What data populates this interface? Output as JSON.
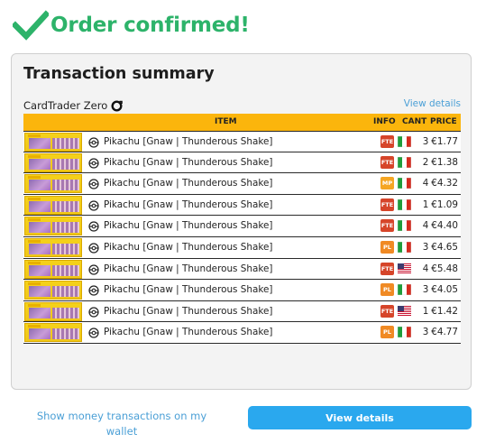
{
  "header": {
    "title": "Order confirmed!",
    "icon": "check-icon",
    "color": "#2db36a"
  },
  "summary": {
    "title": "Transaction summary",
    "seller": "CardTrader Zero",
    "view_details_link": "View details",
    "columns": {
      "item": "ITEM",
      "info": "INFO",
      "cant": "CANT",
      "price": "PRICE"
    },
    "rows": [
      {
        "name": "Pikachu [Gnaw | Thunderous Shake]",
        "condition": "FTE",
        "cond_color": "#d6452a",
        "flag": "it",
        "qty": "3",
        "price": "€1.77"
      },
      {
        "name": "Pikachu [Gnaw | Thunderous Shake]",
        "condition": "FTE",
        "cond_color": "#d6452a",
        "flag": "it",
        "qty": "2",
        "price": "€1.38"
      },
      {
        "name": "Pikachu [Gnaw | Thunderous Shake]",
        "condition": "MP",
        "cond_color": "#f5a623",
        "flag": "it",
        "qty": "4",
        "price": "€4.32"
      },
      {
        "name": "Pikachu [Gnaw | Thunderous Shake]",
        "condition": "FTE",
        "cond_color": "#d6452a",
        "flag": "it",
        "qty": "1",
        "price": "€1.09"
      },
      {
        "name": "Pikachu [Gnaw | Thunderous Shake]",
        "condition": "FTE",
        "cond_color": "#d6452a",
        "flag": "it",
        "qty": "4",
        "price": "€4.40"
      },
      {
        "name": "Pikachu [Gnaw | Thunderous Shake]",
        "condition": "PL",
        "cond_color": "#f08a24",
        "flag": "it",
        "qty": "3",
        "price": "€4.65"
      },
      {
        "name": "Pikachu [Gnaw | Thunderous Shake]",
        "condition": "FTE",
        "cond_color": "#d6452a",
        "flag": "us",
        "qty": "4",
        "price": "€5.48"
      },
      {
        "name": "Pikachu [Gnaw | Thunderous Shake]",
        "condition": "PL",
        "cond_color": "#f08a24",
        "flag": "it",
        "qty": "3",
        "price": "€4.05"
      },
      {
        "name": "Pikachu [Gnaw | Thunderous Shake]",
        "condition": "FTE",
        "cond_color": "#d6452a",
        "flag": "us",
        "qty": "1",
        "price": "€1.42"
      },
      {
        "name": "Pikachu [Gnaw | Thunderous Shake]",
        "condition": "PL",
        "cond_color": "#f08a24",
        "flag": "it",
        "qty": "3",
        "price": "€4.77"
      }
    ]
  },
  "footer": {
    "wallet_link": "Show money transactions on my wallet",
    "view_details_button": "View details"
  },
  "colors": {
    "accent": "#2aa8ee",
    "table_header": "#fbb50c",
    "link": "#4a9fd6"
  }
}
